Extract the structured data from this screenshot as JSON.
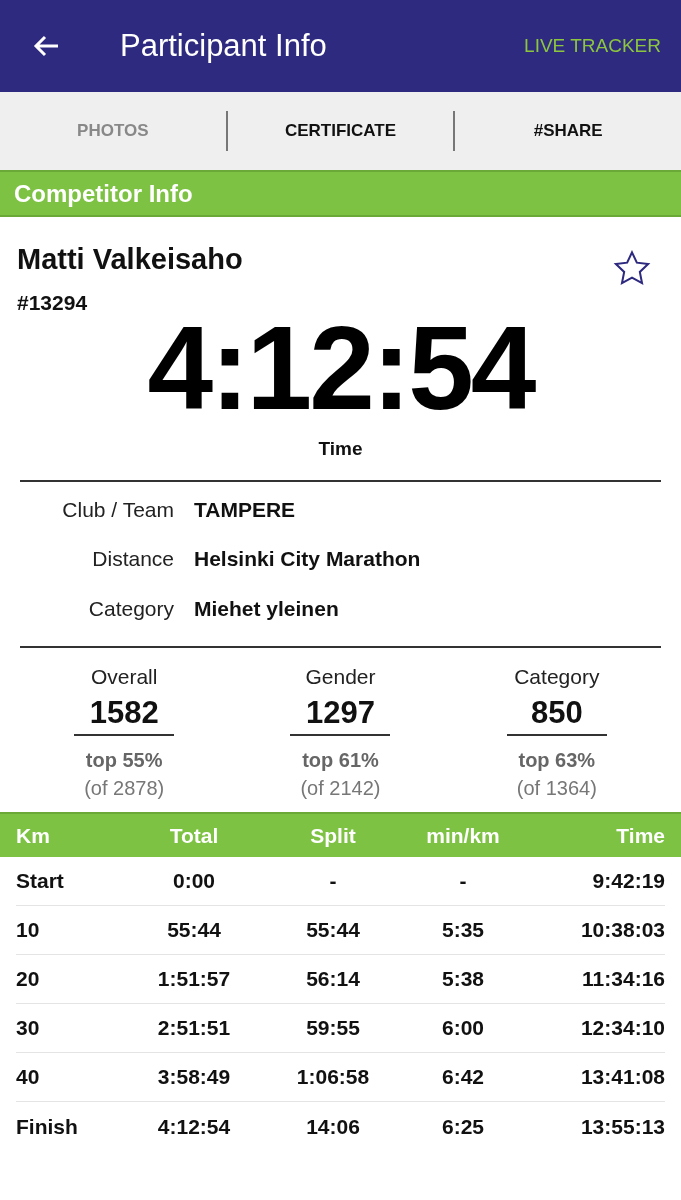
{
  "header": {
    "title": "Participant Info",
    "action": "LIVE TRACKER"
  },
  "tabs": [
    {
      "label": "PHOTOS",
      "disabled": true
    },
    {
      "label": "CERTIFICATE",
      "disabled": false
    },
    {
      "label": "#SHARE",
      "disabled": false
    }
  ],
  "section_title": "Competitor Info",
  "participant": {
    "name": "Matti Valkeisaho",
    "bib": "#13294",
    "favorite": false,
    "time": "4:12:54",
    "time_label": "Time"
  },
  "details": [
    {
      "label": "Club / Team",
      "value": "TAMPERE"
    },
    {
      "label": "Distance",
      "value": "Helsinki City Marathon"
    },
    {
      "label": "Category",
      "value": "Miehet yleinen"
    }
  ],
  "rankings": [
    {
      "label": "Overall",
      "rank": "1582",
      "top": "top 55%",
      "of": "(of 2878)"
    },
    {
      "label": "Gender",
      "rank": "1297",
      "top": "top 61%",
      "of": "(of 2142)"
    },
    {
      "label": "Category",
      "rank": "850",
      "top": "top 63%",
      "of": "(of 1364)"
    }
  ],
  "splits": {
    "columns": [
      "Km",
      "Total",
      "Split",
      "min/km",
      "Time"
    ],
    "rows": [
      [
        "Start",
        "0:00",
        "-",
        "-",
        "9:42:19"
      ],
      [
        "10",
        "55:44",
        "55:44",
        "5:35",
        "10:38:03"
      ],
      [
        "20",
        "1:51:57",
        "56:14",
        "5:38",
        "11:34:16"
      ],
      [
        "30",
        "2:51:51",
        "59:55",
        "6:00",
        "12:34:10"
      ],
      [
        "40",
        "3:58:49",
        "1:06:58",
        "6:42",
        "13:41:08"
      ],
      [
        "Finish",
        "4:12:54",
        "14:06",
        "6:25",
        "13:55:13"
      ]
    ]
  }
}
